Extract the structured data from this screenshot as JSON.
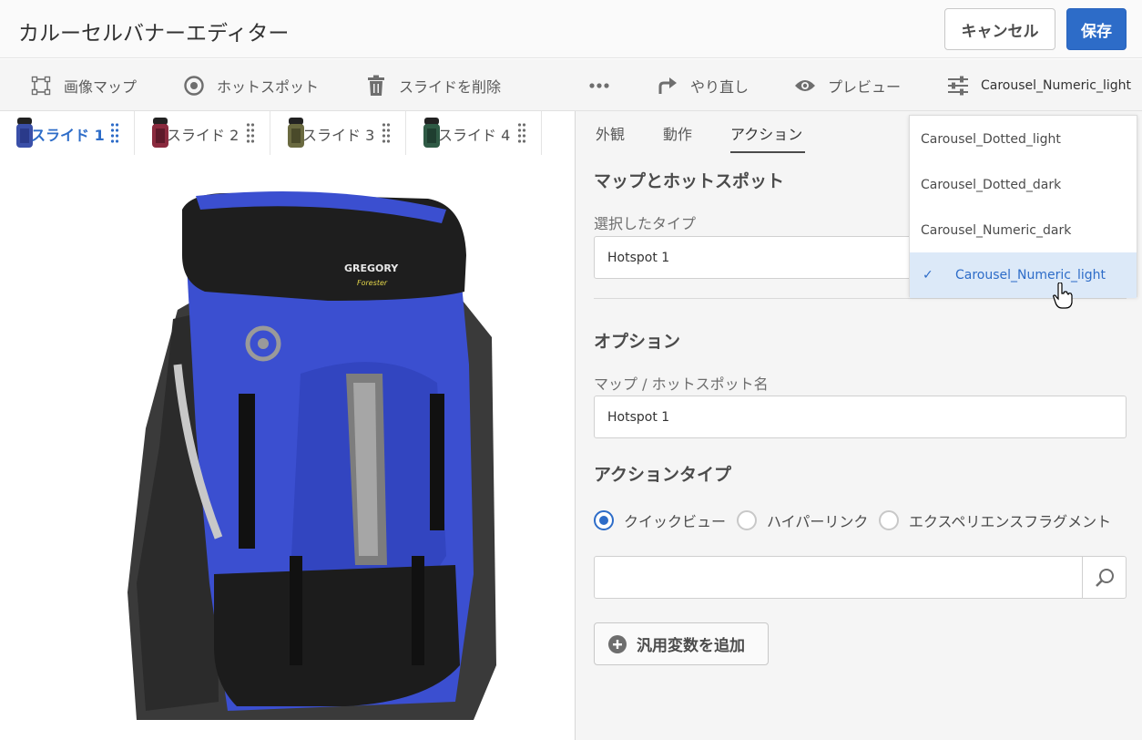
{
  "header": {
    "title": "カルーセルバナーエディター",
    "cancel_label": "キャンセル",
    "save_label": "保存"
  },
  "toolbar": {
    "image_map": "画像マップ",
    "hotspot": "ホットスポット",
    "delete_slide": "スライドを削除",
    "redo": "やり直し",
    "preview": "プレビュー",
    "preset": "Carousel_Numeric_light"
  },
  "slides": [
    {
      "label": "スライド 1",
      "color": "#3a4fa8"
    },
    {
      "label": "スライド 2",
      "color": "#8a2a3e"
    },
    {
      "label": "スライド 3",
      "color": "#6a6a40"
    },
    {
      "label": "スライド 4",
      "color": "#2f5a45"
    }
  ],
  "panel": {
    "tabs": [
      "外観",
      "動作",
      "アクション"
    ],
    "section_map": "マップとホットスポット",
    "selected_type_label": "選択したタイプ",
    "selected_type_value": "Hotspot 1",
    "section_options": "オプション",
    "name_label": "マップ / ホットスポット名",
    "name_value": "Hotspot 1",
    "section_action": "アクションタイプ",
    "radios": [
      "クイックビュー",
      "ハイパーリンク",
      "エクスペリエンスフラグメント"
    ],
    "search_placeholder": "",
    "add_label": "汎用変数を追加"
  },
  "dropdown": {
    "items": [
      "Carousel_Dotted_light",
      "Carousel_Dotted_dark",
      "Carousel_Numeric_dark",
      "Carousel_Numeric_light"
    ],
    "selected": "Carousel_Numeric_light"
  },
  "colors": {
    "accent": "#2d6cc8",
    "backpack_blue": "#3b4fd0",
    "backpack_black": "#1e1e1e"
  },
  "icons": [
    "image-map-icon",
    "hotspot-icon",
    "trash-icon",
    "more-icon",
    "redo-icon",
    "eye-icon",
    "sliders-icon",
    "search-icon",
    "add-circle-icon",
    "check-icon",
    "grip-icon"
  ]
}
